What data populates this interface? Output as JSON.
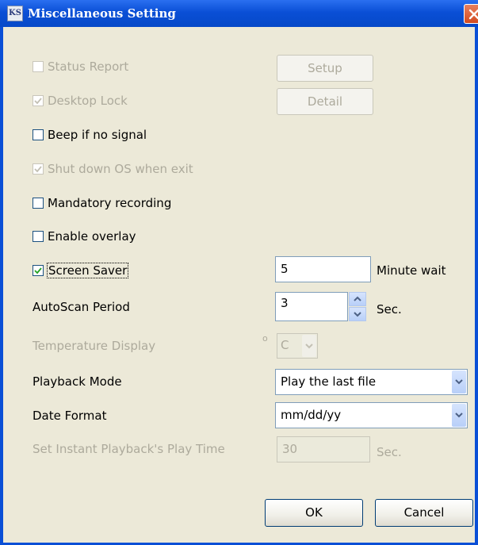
{
  "window": {
    "title": "Miscellaneous Setting",
    "icon_text": "KS"
  },
  "options": {
    "status_report": {
      "label": "Status Report",
      "checked": false,
      "enabled": false
    },
    "desktop_lock": {
      "label": "Desktop Lock",
      "checked": true,
      "enabled": false
    },
    "beep_if_no_signal": {
      "label": "Beep if no signal",
      "checked": false,
      "enabled": true
    },
    "shut_down_os": {
      "label": "Shut down OS when exit",
      "checked": true,
      "enabled": false
    },
    "mandatory_recording": {
      "label": "Mandatory recording",
      "checked": false,
      "enabled": true
    },
    "enable_overlay": {
      "label": "Enable overlay",
      "checked": false,
      "enabled": true
    },
    "screen_saver": {
      "label": "Screen Saver",
      "checked": true,
      "enabled": true
    }
  },
  "buttons": {
    "setup": "Setup",
    "detail": "Detail",
    "ok": "OK",
    "cancel": "Cancel"
  },
  "screen_saver_minutes": "5",
  "minute_wait_label": "Minute wait",
  "autoscan": {
    "label": "AutoScan Period",
    "value": "3",
    "unit": "Sec."
  },
  "temperature": {
    "label": "Temperature Display",
    "degree": "o",
    "unit": "C"
  },
  "playback_mode": {
    "label": "Playback Mode",
    "value": "Play the last file"
  },
  "date_format": {
    "label": "Date Format",
    "value": "mm/dd/yy"
  },
  "instant_playback": {
    "label": "Set Instant Playback's Play Time",
    "value": "30",
    "unit": "Sec."
  },
  "colors": {
    "title_bar": "#0a4fd6",
    "dialog_bg": "#ece9d8",
    "disabled_text": "#adaa9c"
  }
}
